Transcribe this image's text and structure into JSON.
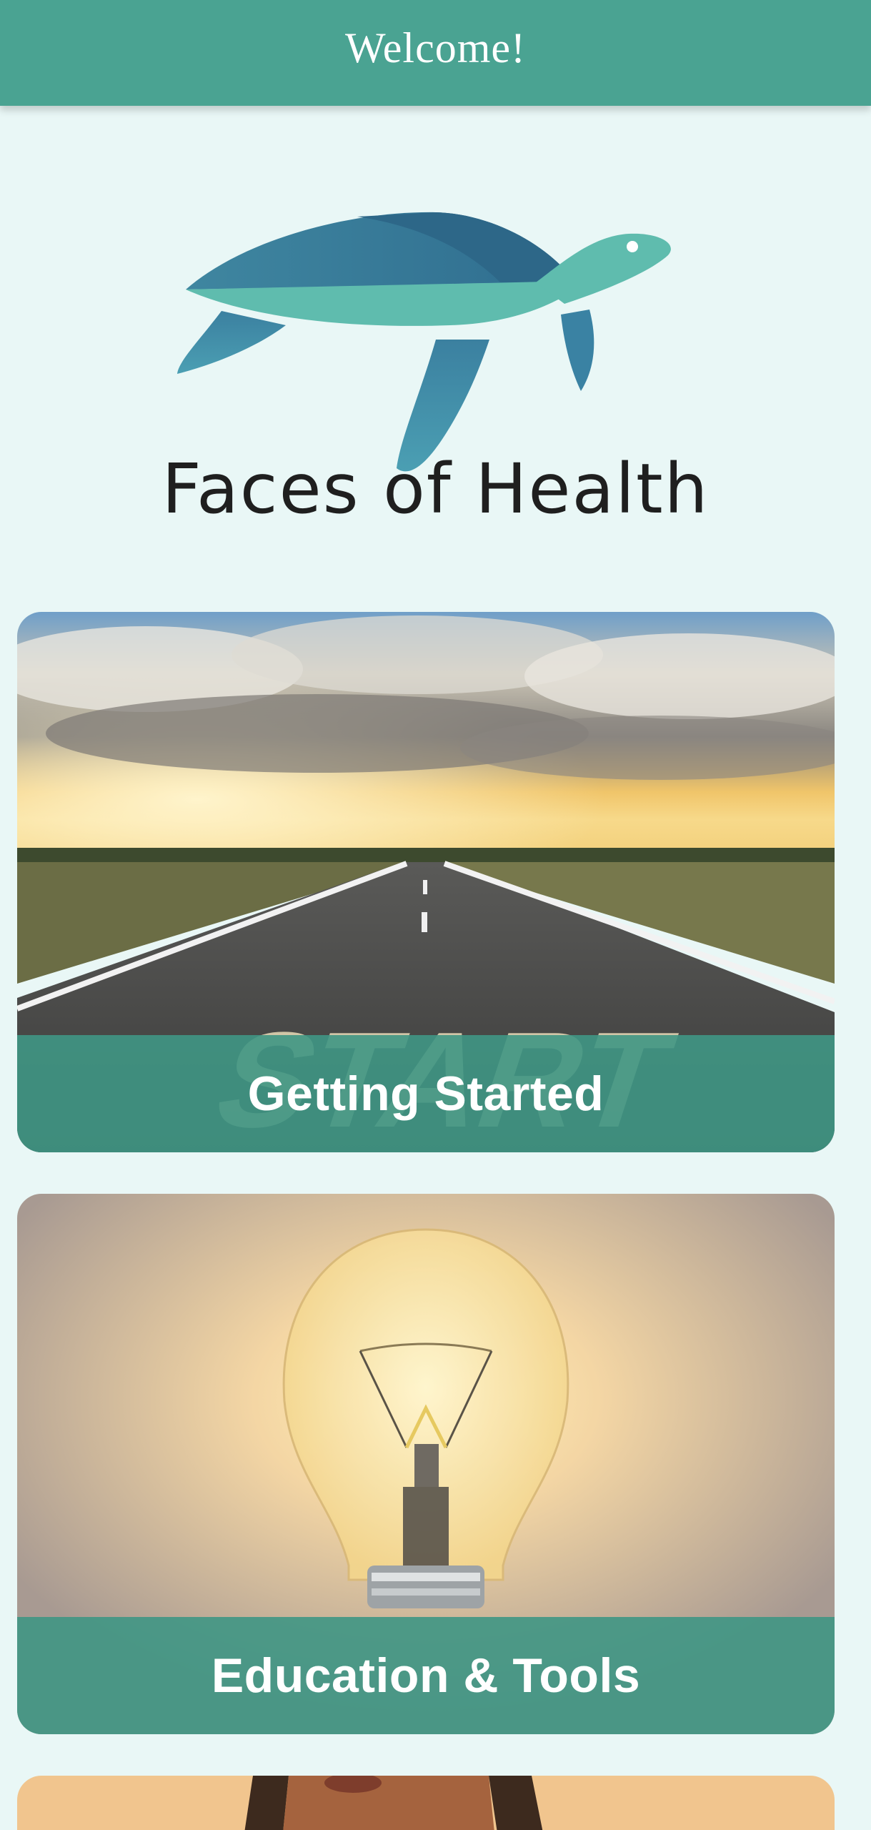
{
  "header": {
    "title": "Welcome!"
  },
  "logo": {
    "brand_name": "Faces of Health",
    "icon": "sea-turtle-logo"
  },
  "cards": [
    {
      "label": "Getting Started",
      "image": "road-start-photo"
    },
    {
      "label": "Education & Tools",
      "image": "lightbulb-photo"
    },
    {
      "label": "",
      "image": "person-portrait-photo"
    }
  ],
  "colors": {
    "header_bg": "#4aa392",
    "page_bg": "#e9f7f6",
    "band_bg": "#3f9684",
    "turtle_dark": "#3d7d9e",
    "turtle_light": "#5fbcae"
  }
}
